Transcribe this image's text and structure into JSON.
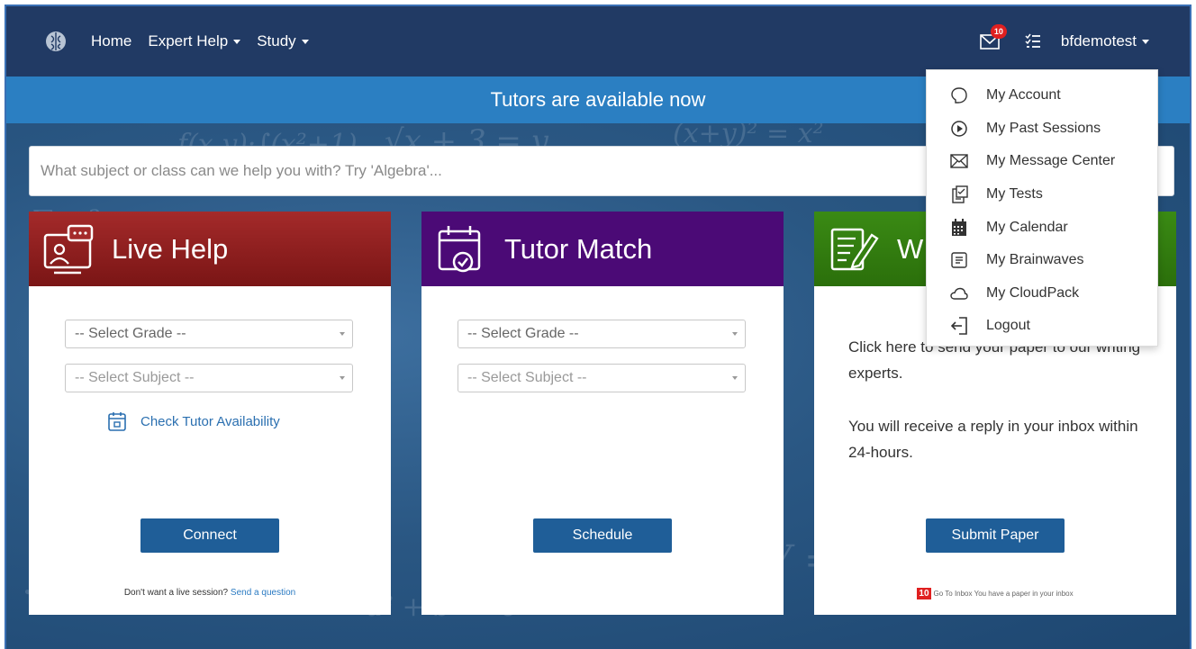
{
  "nav": {
    "home": "Home",
    "expert_help": "Expert Help",
    "study": "Study",
    "mail_badge": "10",
    "username": "bfdemotest"
  },
  "banner": {
    "text": "Tutors are available now"
  },
  "search": {
    "placeholder": "What subject or class can we help you with? Try 'Algebra'..."
  },
  "live_help": {
    "title": "Live Help",
    "grade_placeholder": "-- Select Grade --",
    "subject_placeholder": "-- Select Subject --",
    "availability_link": "Check Tutor Availability",
    "button": "Connect",
    "footer_text": "Don't want a live session?",
    "footer_link": "Send a question"
  },
  "tutor_match": {
    "title": "Tutor Match",
    "grade_placeholder": "-- Select Grade --",
    "subject_placeholder": "-- Select Subject --",
    "button": "Schedule"
  },
  "writing": {
    "title": "W",
    "line1": "Click here to send your paper to our writing experts.",
    "line2": "You will receive a reply in your inbox within 24-hours.",
    "button": "Submit Paper",
    "badge": "10",
    "footer_text": "Go To Inbox You have a paper in your inbox"
  },
  "user_menu": {
    "items": [
      {
        "label": "My Account",
        "icon": "account-icon"
      },
      {
        "label": "My Past Sessions",
        "icon": "play-circle-icon"
      },
      {
        "label": "My Message Center",
        "icon": "envelope-icon"
      },
      {
        "label": "My Tests",
        "icon": "tests-icon"
      },
      {
        "label": "My Calendar",
        "icon": "calendar-icon"
      },
      {
        "label": "My Brainwaves",
        "icon": "brainwaves-icon"
      },
      {
        "label": "My CloudPack",
        "icon": "cloud-icon"
      },
      {
        "label": "Logout",
        "icon": "logout-icon"
      }
    ]
  },
  "colors": {
    "navbar": "#213a64",
    "banner": "#2b7fc2",
    "live_help_head": "#8b1f1f",
    "tutor_match_head": "#4b0a76",
    "writing_head": "#348010",
    "button": "#1f5e98"
  }
}
